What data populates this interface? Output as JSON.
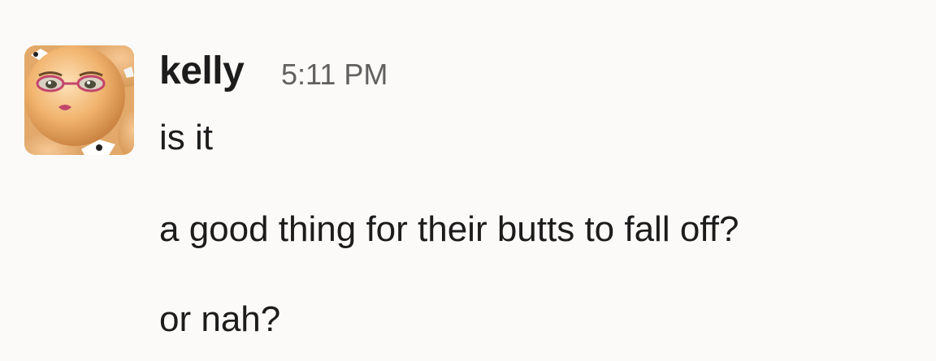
{
  "message": {
    "sender": "kelly",
    "timestamp": "5:11 PM",
    "avatar_icon": "egg-face-avatar",
    "lines": [
      "is it",
      "a good thing for their butts to fall off?",
      "or nah?"
    ]
  }
}
